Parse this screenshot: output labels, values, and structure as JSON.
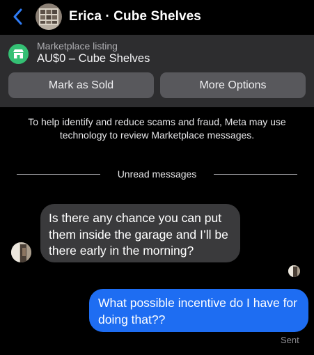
{
  "header": {
    "title": "Erica · Cube Shelves",
    "back_icon": "chevron-left-icon"
  },
  "listing": {
    "label": "Marketplace listing",
    "title": "AU$0 – Cube Shelves",
    "icon": "marketplace-store-icon",
    "mark_sold_label": "Mark as Sold",
    "more_options_label": "More Options"
  },
  "notice": {
    "text": "To help identify and reduce scams and fraud, Meta may use technology to review Marketplace messages."
  },
  "divider": {
    "label": "Unread messages"
  },
  "messages": [
    {
      "direction": "incoming",
      "text": "Is there any chance you can put them inside the garage and I’ll be there early in the morning?"
    },
    {
      "direction": "outgoing",
      "text": "What possible incentive do I have for doing that??",
      "status": "Sent"
    }
  ],
  "colors": {
    "accent": "#1e6df2",
    "back_arrow": "#2f7cf6",
    "marketplace_green": "#34c074",
    "incoming_bubble": "#3a3a3c",
    "panel": "#2d2d2f"
  }
}
